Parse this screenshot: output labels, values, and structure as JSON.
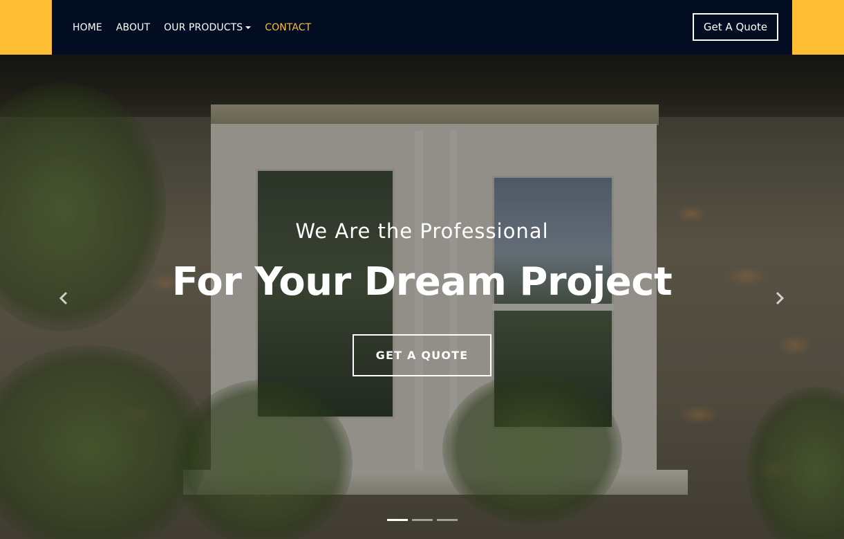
{
  "nav": {
    "items": [
      {
        "label": "HOME"
      },
      {
        "label": "ABOUT"
      },
      {
        "label": "OUR PRODUCTS"
      },
      {
        "label": "CONTACT"
      }
    ],
    "quote_button": "Get A Quote"
  },
  "hero": {
    "subtitle": "We Are the Professional",
    "title": "For Your Dream Project",
    "cta": "GET A QUOTE",
    "slides_count": 3,
    "active_slide": 1
  },
  "icons": {
    "prev": "chevron-left-icon",
    "next": "chevron-right-icon",
    "dropdown": "caret-down-icon"
  },
  "colors": {
    "accent": "#fdbe34",
    "navbar_bg": "#020d21",
    "text": "#ffffff"
  }
}
